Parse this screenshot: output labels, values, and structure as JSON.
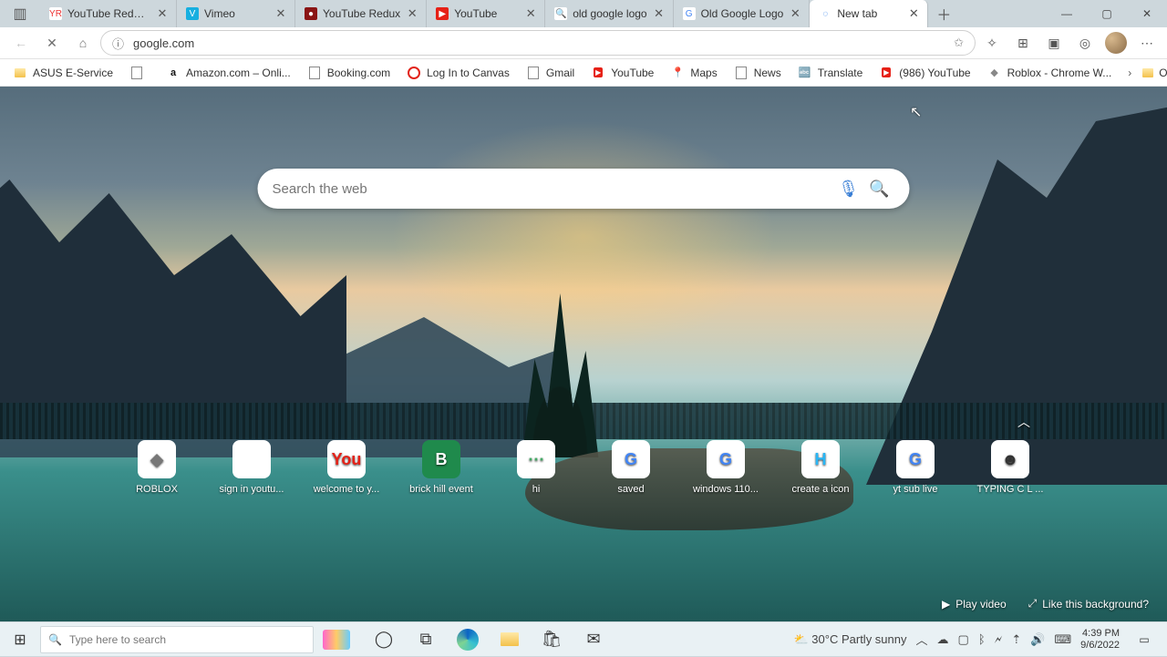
{
  "tabs": [
    {
      "title": "YouTube Redux -",
      "icon": "YR",
      "bg": "#fff",
      "clr": "#e33"
    },
    {
      "title": "Vimeo",
      "icon": "V",
      "bg": "#17afe0",
      "clr": "#fff"
    },
    {
      "title": "YouTube Redux",
      "icon": "●",
      "bg": "#8a1515",
      "clr": "#fff"
    },
    {
      "title": "YouTube",
      "icon": "▶",
      "bg": "#e62117",
      "clr": "#fff"
    },
    {
      "title": "old google logo",
      "icon": "🔍",
      "bg": "#fff",
      "clr": "#4285f4"
    },
    {
      "title": "Old Google Logo",
      "icon": "G",
      "bg": "#fff",
      "clr": "#4285f4"
    },
    {
      "title": "New tab",
      "icon": "◌",
      "bg": "#fff",
      "clr": "#1a73e8",
      "active": true
    }
  ],
  "address": {
    "url": "google.com"
  },
  "bookmarks": [
    {
      "label": "ASUS E-Service",
      "icon": "folder"
    },
    {
      "label": "",
      "icon": "page"
    },
    {
      "label": "Amazon.com – Onli...",
      "icon": "a"
    },
    {
      "label": "Booking.com",
      "icon": "page"
    },
    {
      "label": "Log In to Canvas",
      "icon": "canvas"
    },
    {
      "label": "Gmail",
      "icon": "page"
    },
    {
      "label": "YouTube",
      "icon": "yt"
    },
    {
      "label": "Maps",
      "icon": "pin"
    },
    {
      "label": "News",
      "icon": "page"
    },
    {
      "label": "Translate",
      "icon": "tr"
    },
    {
      "label": "(986) YouTube",
      "icon": "yt"
    },
    {
      "label": "Roblox - Chrome W...",
      "icon": "rb"
    }
  ],
  "other_fav": "Other favorites",
  "search": {
    "placeholder": "Search the web"
  },
  "quicklinks": [
    {
      "label": "ROBLOX",
      "tile": "◆",
      "clr": "#777"
    },
    {
      "label": "sign in youtu...",
      "tile": "",
      "clr": "#fff"
    },
    {
      "label": "welcome to y...",
      "tile": "You",
      "clr": "#e62117"
    },
    {
      "label": "brick hill event",
      "tile": "B",
      "clr": "#fff",
      "bg": "#1f8a4c"
    },
    {
      "label": "hi",
      "tile": "⋯",
      "clr": "#4a6"
    },
    {
      "label": "saved",
      "tile": "G",
      "clr": "#4285f4"
    },
    {
      "label": "windows 110...",
      "tile": "G",
      "clr": "#4285f4"
    },
    {
      "label": "create a icon",
      "tile": "H",
      "clr": "#29b6f6"
    },
    {
      "label": "yt sub live",
      "tile": "G",
      "clr": "#4285f4"
    },
    {
      "label": "TYPING C L ...",
      "tile": "☻",
      "clr": "#333"
    }
  ],
  "bg_actions": {
    "play": "Play video",
    "like": "Like this background?"
  },
  "taskbar": {
    "search_placeholder": "Type here to search",
    "weather_temp": "30°C",
    "weather_desc": "Partly sunny",
    "time": "4:39 PM",
    "date": "9/6/2022"
  }
}
